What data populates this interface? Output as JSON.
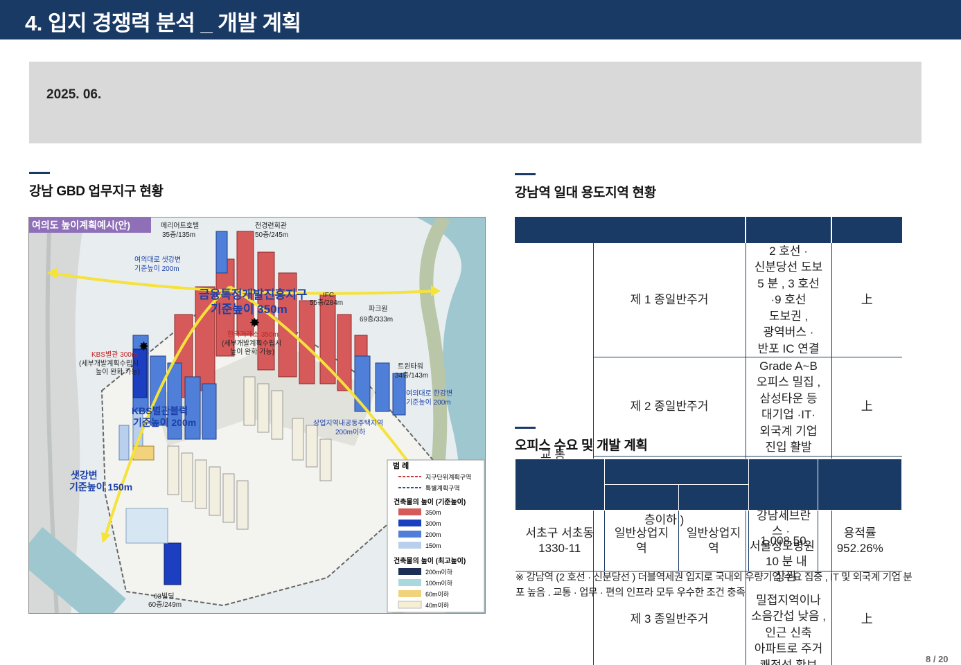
{
  "title": "4.  입지 경쟁력 분석 _ 개발 계획",
  "date": "2025. 06.",
  "section_left": {
    "heading": "강남  GBD  업무지구 현황",
    "map": {
      "tag": "여의도 높이계획예시(안)",
      "labels": {
        "meridian": "메리어트호텔",
        "meridian_h": "35층/135m",
        "jeongyeong": "전경련회관",
        "jeongyeong_h": "50층/245m",
        "yeouidaero": "여의대로 샛강변",
        "yeouidaero_h": "기준높이 200m",
        "finance": "금융특정개발진흥지구",
        "finance_h": "기준높이 350m",
        "ifc": "IFC",
        "ifc_h": "55층/284m",
        "parkone": "파크원",
        "parkone_h": "69층/333m",
        "hanguk": "한국거래소 350m",
        "hanguk_sub1": "(세부개발계획수립시",
        "hanguk_sub2": "높이 완화 가능)",
        "kbs": "KBS별관 300m",
        "kbs_sub1": "(세부개발계획수립시",
        "kbs_sub2": "높이 완화 가능)",
        "twin": "트윈타워",
        "twin_h": "34층/143m",
        "yeouidaero2": "여의대로 한강변",
        "yeouidaero2_h": "기준높이 200m",
        "kbs_block": "KBS별관블럭",
        "kbs_block_h": "기준높이 200m",
        "commercial": "상업지역내공동주택지역",
        "commercial_h": "200m이하",
        "saetgang": "샛강변",
        "saetgang_h": "기준높이 150m",
        "b63": "63빌딩",
        "b63_h": "60층/249m"
      },
      "legend": {
        "title": "범   례",
        "items": [
          {
            "label": "지구단위계획구역",
            "color": "#c23a3a"
          },
          {
            "label": "특별계획구역",
            "color": "#2a4c9a"
          }
        ],
        "base_title": "건축물의 높이 (기준높이)",
        "base": [
          {
            "label": "350m",
            "color": "#d65a5a"
          },
          {
            "label": "300m",
            "color": "#1c3fc2"
          },
          {
            "label": "200m",
            "color": "#4f7fd8"
          },
          {
            "label": "150m",
            "color": "#b8cfee"
          }
        ],
        "max_title": "건축물의 높이 (최고높이)",
        "max": [
          {
            "label": "200m이하",
            "color": "#1b2f55"
          },
          {
            "label": "100m이하",
            "color": "#a9d8dd"
          },
          {
            "label": "60m이하",
            "color": "#f2d27a"
          },
          {
            "label": "40m이하",
            "color": "#f7efd3"
          }
        ]
      }
    }
  },
  "section_right": {
    "heading": "강남역 일대 용도지역 현황",
    "rows": [
      {
        "zone": "제 1 종일반주거",
        "desc": [
          "2 호선 ·",
          "신분당선 도보",
          "5 분 , 3 호선",
          "·9 호선",
          "도보권 ,",
          "광역버스 ·",
          "반포 IC  연결"
        ],
        "grade": "上"
      },
      {
        "zone": "제 2 종일반주거",
        "desc": [
          "Grade A~B",
          "오피스 밀집 ,",
          "삼성타운 등",
          "대기업 ·IT·",
          "외국계 기업",
          "진입 활발"
        ],
        "grade": "上"
      },
      {
        "zone": "제 3 종일반주거",
        "desc": [
          "밀접지역이나",
          "소음간섭 낮음 ,",
          "인근 신축",
          "아파트로 주거",
          "쾌적성 확보"
        ],
        "grade": "上"
      }
    ],
    "row_label": "교 통",
    "overlap_fragments": {
      "frag1": "층이하 )",
      "frag2": "강남세브란",
      "frag3": "스 ·",
      "frag4": "서울성모병원",
      "frag5": "10 분 내",
      "frag6": "상권"
    }
  },
  "section_office": {
    "heading": "오피스 수요 및 개발 계획",
    "row": {
      "address": [
        "서초구 서초동",
        "1330-11"
      ],
      "zone_a": [
        "일반상업지",
        "역"
      ],
      "zone_b": [
        "일반상업지",
        "역"
      ],
      "area": "1,008.50",
      "far_label": "용적률",
      "far": "952.26%"
    }
  },
  "note": "※ 강남역 (2 호선 · 신분당선 )  더블역세권 입지로 국내외 우량기업 수요 집중 , IT  및 외국계 기업 분포 높음 .  교통 · 업무 · 편의 인프라 모두 우수한 조건 충족",
  "page": "8 / 20"
}
